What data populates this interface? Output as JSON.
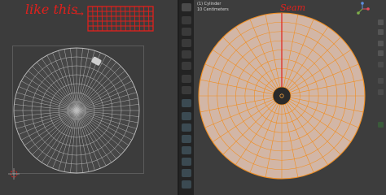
{
  "annotations": {
    "like_this": "like this",
    "arrow": "→",
    "seam": "Seam"
  },
  "viewport_info": {
    "line1": "(1) Cylinder",
    "line2": "10 Centimeters"
  },
  "icons": {
    "left_cursor": "3d-cursor-icon",
    "sphere_nav": "navigation-gizmo-icon",
    "zoom": "zoom-icon",
    "pan": "pan-icon",
    "camera": "camera-icon",
    "grid": "grid-icon"
  },
  "colors": {
    "mesh_face": "#d2b6a6",
    "edge_selected": "#f08e22",
    "seam": "#e0201c",
    "uv_wire": "#bdbdbd",
    "viewport_bg": "#3d3d3d"
  }
}
